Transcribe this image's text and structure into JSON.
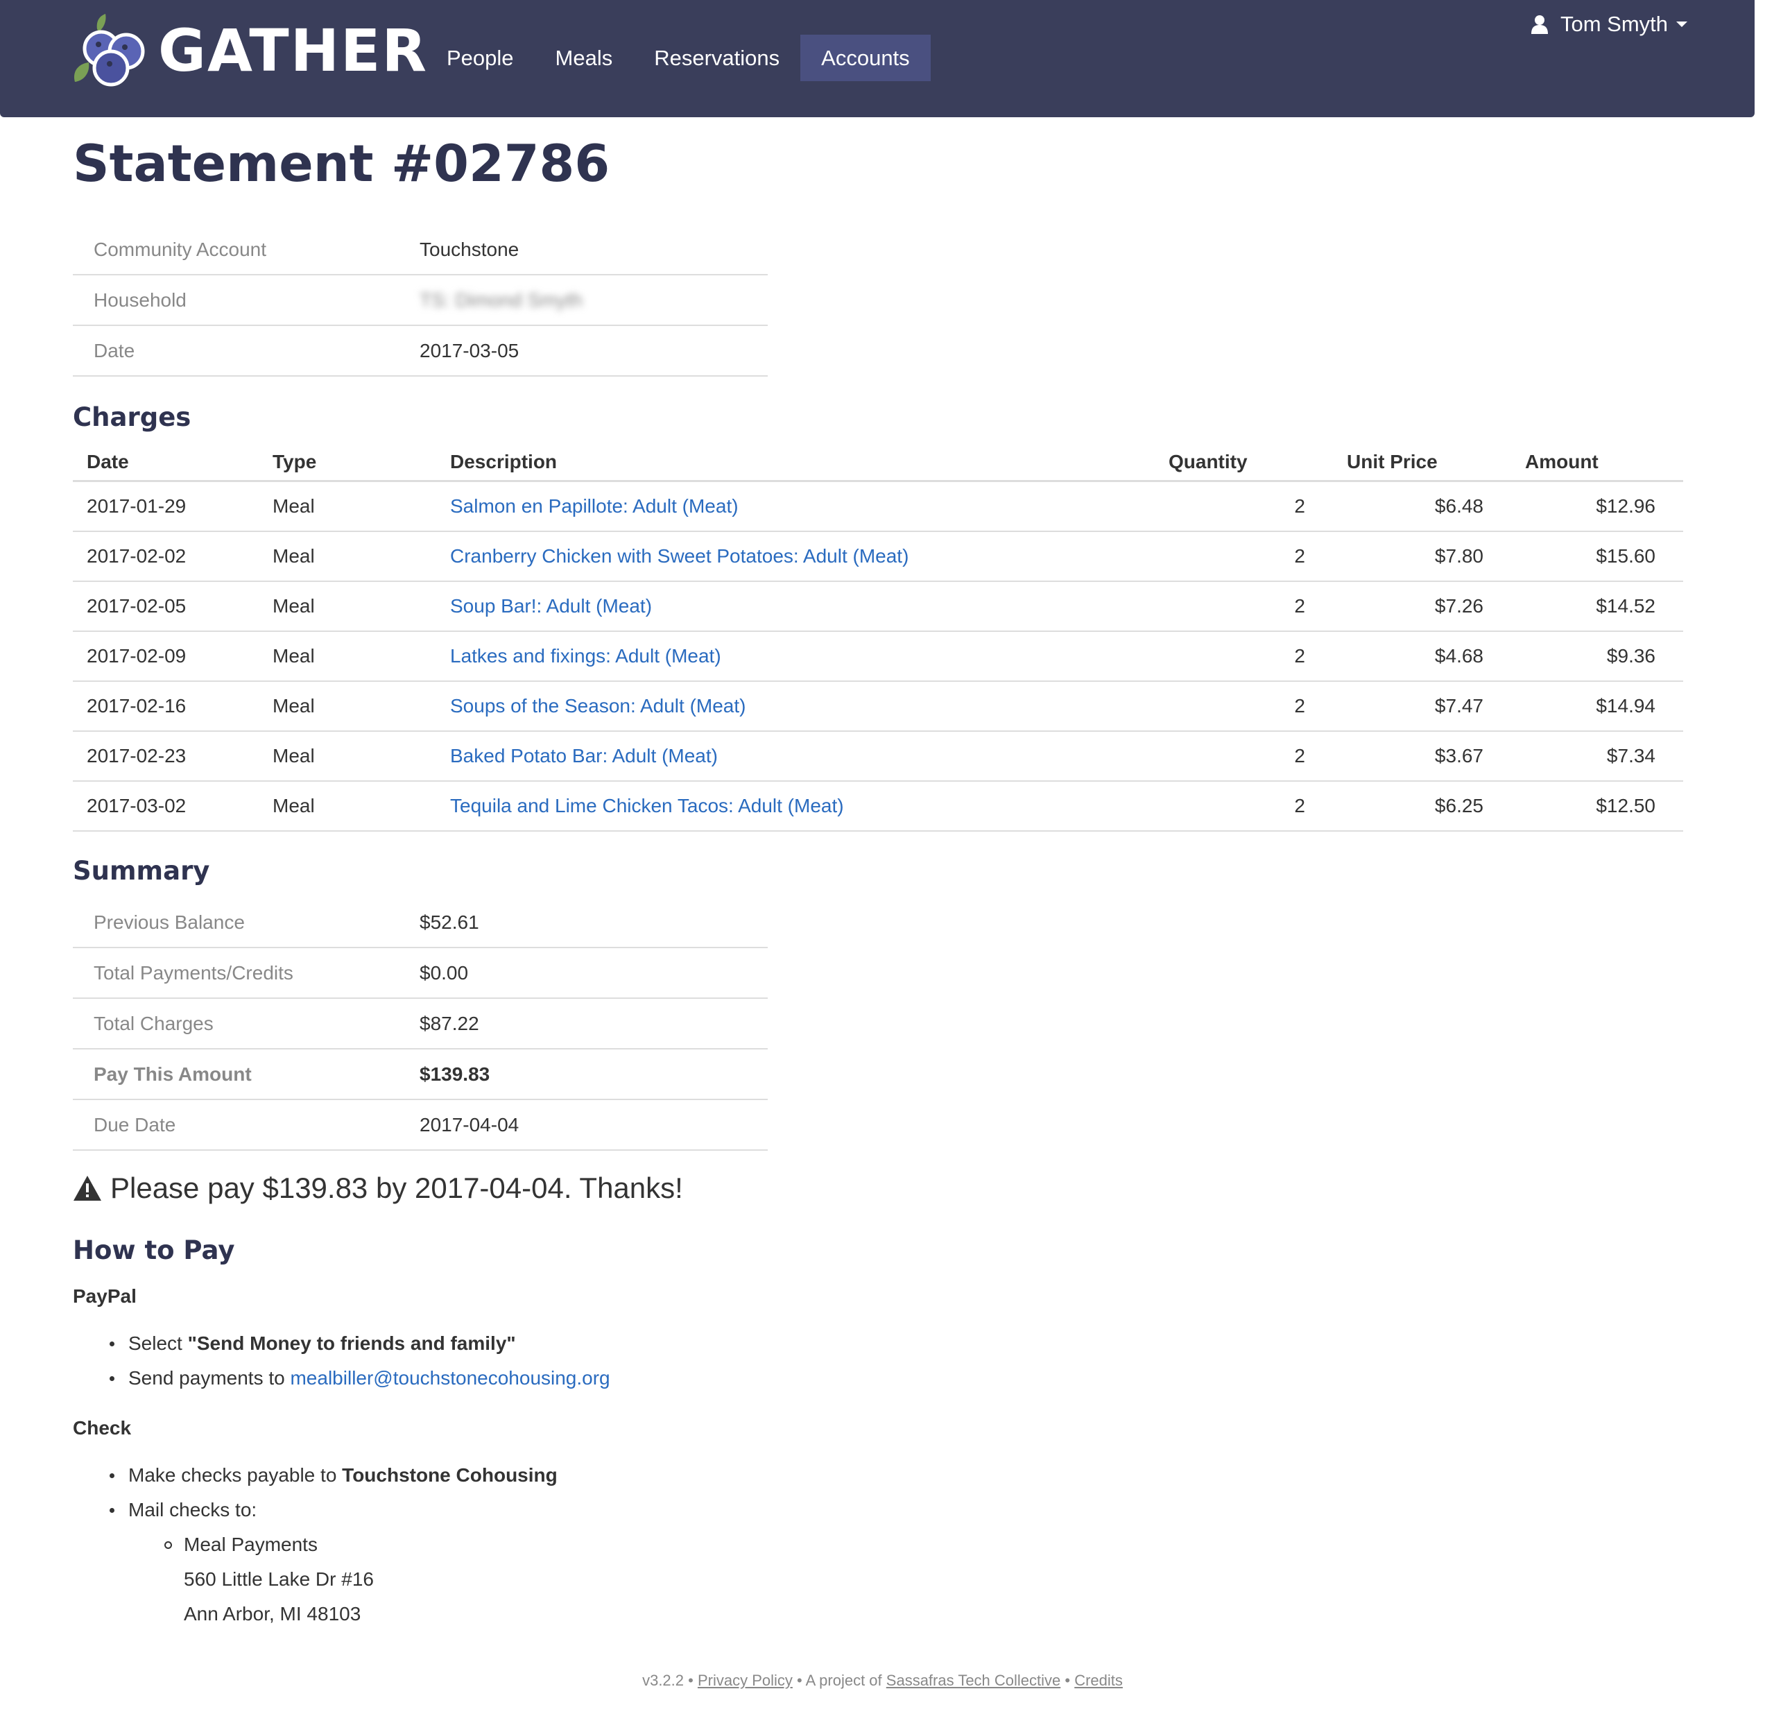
{
  "nav": {
    "brand": "GATHER",
    "items": [
      {
        "label": "People",
        "active": false
      },
      {
        "label": "Meals",
        "active": false
      },
      {
        "label": "Reservations",
        "active": false
      },
      {
        "label": "Accounts",
        "active": true
      }
    ],
    "user": "Tom Smyth"
  },
  "colors": {
    "navbar": "#3a3e5b",
    "nav_active": "#4a5080",
    "title": "#2f3350",
    "link": "#2a6bbf"
  },
  "statement": {
    "title": "Statement #02786",
    "info": [
      {
        "label": "Community Account",
        "value": "Touchstone"
      },
      {
        "label": "Household",
        "value": "TS: Dimond Smyth"
      },
      {
        "label": "Date",
        "value": "2017-03-05"
      }
    ]
  },
  "charges": {
    "title": "Charges",
    "headers": [
      "Date",
      "Type",
      "Description",
      "Quantity",
      "Unit Price",
      "Amount"
    ],
    "rows": [
      {
        "date": "2017-01-29",
        "type": "Meal",
        "description": "Salmon en Papillote: Adult (Meat)",
        "quantity": "2",
        "unit_price": "$6.48",
        "amount": "$12.96"
      },
      {
        "date": "2017-02-02",
        "type": "Meal",
        "description": "Cranberry Chicken with Sweet Potatoes: Adult (Meat)",
        "quantity": "2",
        "unit_price": "$7.80",
        "amount": "$15.60"
      },
      {
        "date": "2017-02-05",
        "type": "Meal",
        "description": "Soup Bar!: Adult (Meat)",
        "quantity": "2",
        "unit_price": "$7.26",
        "amount": "$14.52"
      },
      {
        "date": "2017-02-09",
        "type": "Meal",
        "description": "Latkes and fixings: Adult (Meat)",
        "quantity": "2",
        "unit_price": "$4.68",
        "amount": "$9.36"
      },
      {
        "date": "2017-02-16",
        "type": "Meal",
        "description": "Soups of the Season: Adult (Meat)",
        "quantity": "2",
        "unit_price": "$7.47",
        "amount": "$14.94"
      },
      {
        "date": "2017-02-23",
        "type": "Meal",
        "description": "Baked Potato Bar: Adult (Meat)",
        "quantity": "2",
        "unit_price": "$3.67",
        "amount": "$7.34"
      },
      {
        "date": "2017-03-02",
        "type": "Meal",
        "description": "Tequila and Lime Chicken Tacos: Adult (Meat)",
        "quantity": "2",
        "unit_price": "$6.25",
        "amount": "$12.50"
      }
    ]
  },
  "summary": {
    "title": "Summary",
    "rows": [
      {
        "label": "Previous Balance",
        "value": "$52.61",
        "strong": false
      },
      {
        "label": "Total Payments/Credits",
        "value": "$0.00",
        "strong": false
      },
      {
        "label": "Total Charges",
        "value": "$87.22",
        "strong": false
      },
      {
        "label": "Pay This Amount",
        "value": "$139.83",
        "strong": true
      },
      {
        "label": "Due Date",
        "value": "2017-04-04",
        "strong": false
      }
    ]
  },
  "alert": "Please pay $139.83 by 2017-04-04. Thanks!",
  "how_to_pay": {
    "title": "How to Pay",
    "paypal": {
      "title": "PayPal",
      "item1_prefix": "Select ",
      "item1_bold": "\"Send Money to friends and family\"",
      "item2_prefix": "Send payments to ",
      "item2_link": "mealbiller@touchstonecohousing.org"
    },
    "check": {
      "title": "Check",
      "item1_prefix": "Make checks payable to ",
      "item1_bold": "Touchstone Cohousing",
      "item2": "Mail checks to:",
      "address": [
        "Meal Payments",
        "560 Little Lake Dr #16",
        "Ann Arbor, MI 48103"
      ]
    }
  },
  "footer": {
    "version": "v3.2.2",
    "sep": " • ",
    "privacy": "Privacy Policy",
    "project_prefix": "A project of ",
    "collective": "Sassafras Tech Collective",
    "credits": "Credits"
  }
}
